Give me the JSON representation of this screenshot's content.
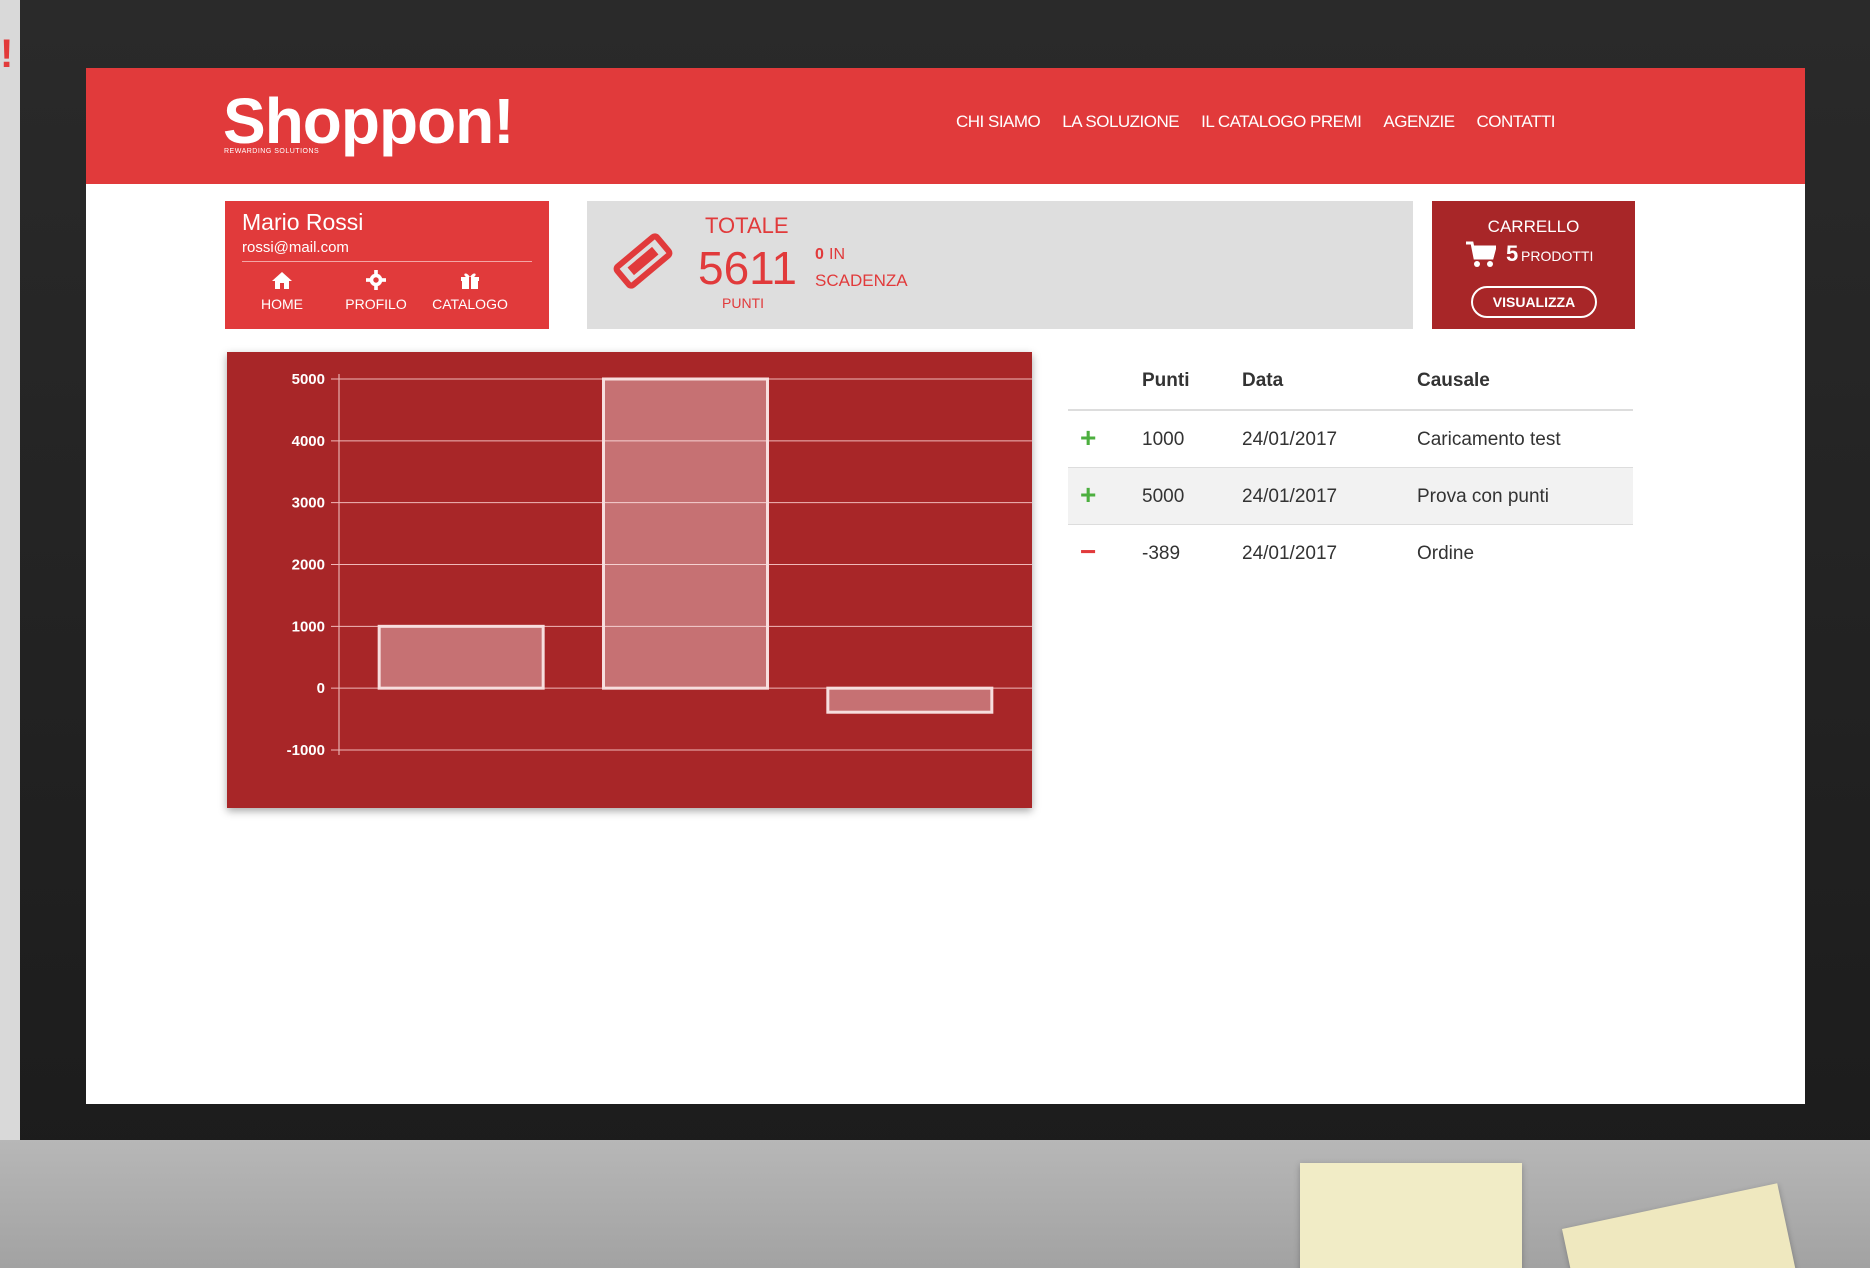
{
  "brand": {
    "corner_text": "!",
    "logo_text": "Shoppon!",
    "logo_subtitle": "REWARDING SOLUTIONS",
    "primary_color": "#e13a3b",
    "dark_red": "#a82628"
  },
  "nav": {
    "items": [
      "CHI SIAMO",
      "LA SOLUZIONE",
      "IL CATALOGO PREMI",
      "AGENZIE",
      "CONTATTI"
    ]
  },
  "user": {
    "name": "Mario Rossi",
    "email": "rossi@mail.com",
    "links": [
      {
        "label": "HOME",
        "icon": "home-icon"
      },
      {
        "label": "PROFILO",
        "icon": "gear-icon"
      },
      {
        "label": "CATALOGO",
        "icon": "gift-icon"
      }
    ]
  },
  "totals": {
    "label": "TOTALE",
    "value": "5611",
    "unit": "PUNTI",
    "expiring_count": "0",
    "expiring_in": "IN",
    "expiring_label": "SCADENZA"
  },
  "cart": {
    "title": "CARRELLO",
    "count": "5",
    "unit": "PRODOTTI",
    "button": "VISUALIZZA"
  },
  "chart_data": {
    "type": "bar",
    "categories": [
      "",
      "",
      ""
    ],
    "values": [
      1000,
      5000,
      -389
    ],
    "ylim": [
      -1000,
      5000
    ],
    "yticks": [
      5000,
      4000,
      3000,
      2000,
      1000,
      0,
      -1000
    ],
    "grid": true
  },
  "transactions": {
    "headers": {
      "points": "Punti",
      "date": "Data",
      "reason": "Causale"
    },
    "rows": [
      {
        "sign": "+",
        "points": "1000",
        "date": "24/01/2017",
        "reason": "Caricamento test"
      },
      {
        "sign": "+",
        "points": "5000",
        "date": "24/01/2017",
        "reason": "Prova con punti"
      },
      {
        "sign": "−",
        "points": "-389",
        "date": "24/01/2017",
        "reason": "Ordine"
      }
    ]
  }
}
